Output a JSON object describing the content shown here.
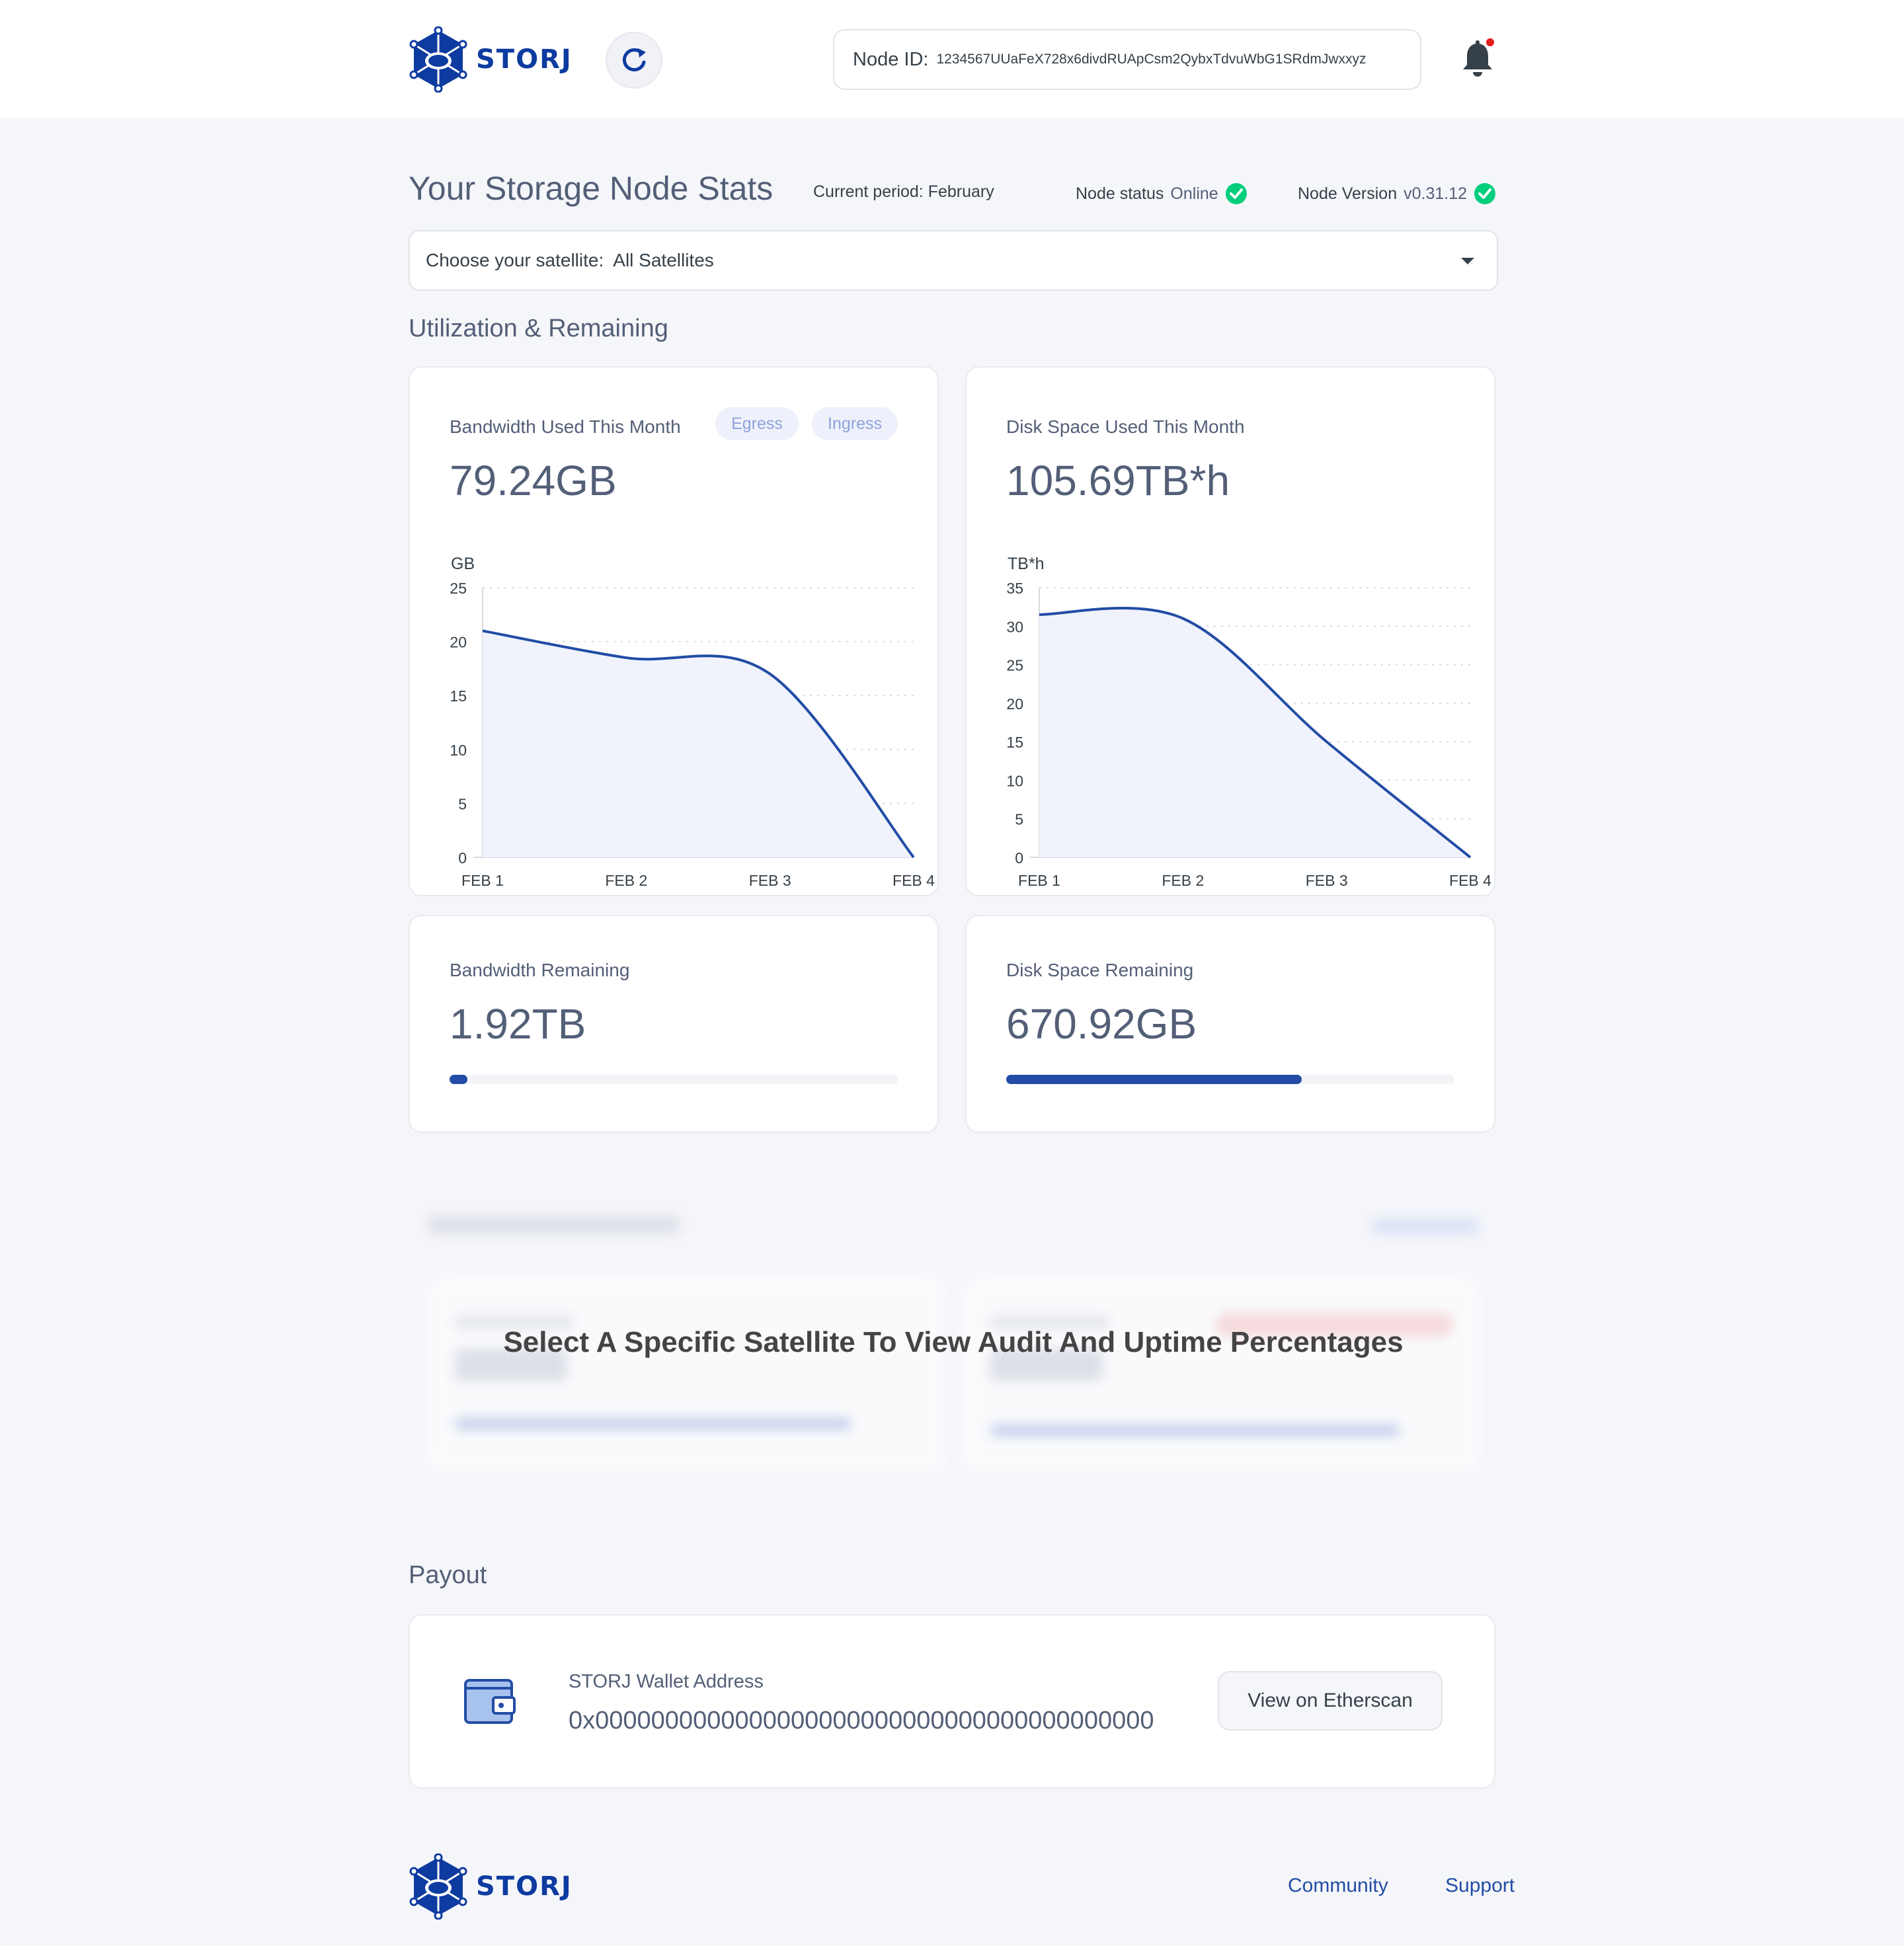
{
  "header": {
    "logo_text": "STORJ",
    "node_id_label": "Node ID:",
    "node_id_value": "1234567UUaFeX728x6divdRUApCsm2QybxTdvuWbG1SRdmJwxxyz"
  },
  "stats": {
    "title": "Your Storage Node Stats",
    "current_period": "Current period: February",
    "node_status_label": "Node status",
    "node_status_value": "Online",
    "node_version_label": "Node Version",
    "node_version_value": "v0.31.12"
  },
  "satellite": {
    "label": "Choose your satellite:",
    "selected": "All Satellites"
  },
  "utilization": {
    "title": "Utilization & Remaining",
    "bandwidth_used": {
      "label": "Bandwidth Used This Month",
      "value": "79.24GB",
      "egress_label": "Egress",
      "ingress_label": "Ingress"
    },
    "disk_used": {
      "label": "Disk Space Used This Month",
      "value": "105.69TB*h"
    },
    "bandwidth_remaining": {
      "label": "Bandwidth Remaining",
      "value": "1.92TB",
      "fraction": 0.04
    },
    "disk_remaining": {
      "label": "Disk Space Remaining",
      "value": "670.92GB",
      "fraction": 0.66
    }
  },
  "chart_data": [
    {
      "type": "area",
      "ylabel": "GB",
      "x": [
        "FEB 1",
        "FEB 2",
        "FEB 3",
        "FEB 4"
      ],
      "values": [
        21,
        18.5,
        17,
        0
      ],
      "yticks": [
        0,
        5,
        10,
        15,
        20,
        25
      ],
      "ylim": [
        0,
        25
      ],
      "grid": true,
      "color": "#224ca5",
      "fill": "#f0f3fc"
    },
    {
      "type": "area",
      "ylabel": "TB*h",
      "x": [
        "FEB 1",
        "FEB 2",
        "FEB 3",
        "FEB 4"
      ],
      "values": [
        31.5,
        31,
        15,
        0
      ],
      "yticks": [
        0,
        5,
        10,
        15,
        20,
        25,
        30,
        35
      ],
      "ylim": [
        0,
        35
      ],
      "grid": true,
      "color": "#224ca5",
      "fill": "#f0f3fc"
    }
  ],
  "audit": {
    "message": "Select A Specific Satellite To View Audit And Uptime Percentages"
  },
  "payout": {
    "title": "Payout",
    "wallet_label": "STORJ Wallet Address",
    "wallet_address": "0x0000000000000000000000000000000000000000",
    "etherscan_button": "View on Etherscan"
  },
  "footer": {
    "logo_text": "STORJ",
    "community": "Community",
    "support": "Support"
  },
  "colors": {
    "brand": "#0d3ba0",
    "accent": "#224ca5",
    "online": "#00ce7d",
    "notification": "#e51c1c"
  }
}
